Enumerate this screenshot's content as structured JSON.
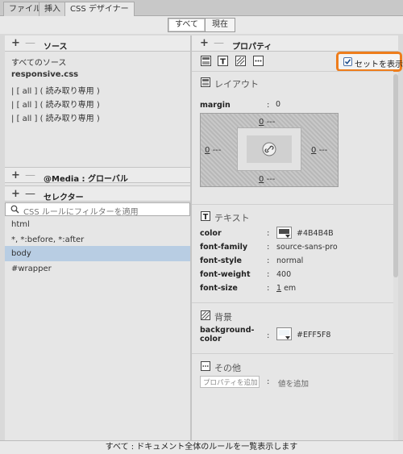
{
  "tabs": [
    {
      "label": "ファイル"
    },
    {
      "label": "挿入"
    },
    {
      "label": "CSS デザイナー"
    }
  ],
  "top_buttons": {
    "all": "すべて",
    "current": "現在"
  },
  "sources": {
    "title": "ソース",
    "all_sources": "すべてのソース",
    "file": "responsive.css",
    "items": [
      "[ all ] ( 読み取り専用 )",
      "[ all ] ( 読み取り専用 )",
      "[ all ] ( 読み取り専用 )"
    ]
  },
  "media": {
    "title": "@Media : グローバル"
  },
  "selectors": {
    "title": "セレクター",
    "filter_placeholder": "CSS ルールにフィルターを適用",
    "items": [
      "html",
      "*, *:before, *:after",
      "body",
      "#wrapper"
    ]
  },
  "properties": {
    "title": "プロパティ",
    "show_set_label": "セットを表示",
    "show_set_checked": true
  },
  "layout": {
    "title": "レイアウト",
    "margin_label": "margin",
    "margin_value": "0",
    "box_top": "0",
    "box_top_dash": "---",
    "box_left": "0",
    "box_left_dash": "---",
    "box_right": "0",
    "box_right_dash": "---",
    "box_bottom": "0",
    "box_bottom_dash": "---"
  },
  "text": {
    "title": "テキスト",
    "props": [
      {
        "name": "color",
        "value": "#4B4B4B"
      },
      {
        "name": "font-family",
        "value": "source-sans-pro"
      },
      {
        "name": "font-style",
        "value": "normal"
      },
      {
        "name": "font-weight",
        "value": "400"
      },
      {
        "name": "font-size",
        "num": "1",
        "unit": "em"
      }
    ],
    "swatch_color": "#4B4B4B"
  },
  "background": {
    "title": "背景",
    "prop_line1": "background-",
    "prop_line2": "color",
    "value": "#EFF5F8",
    "swatch_color": "#EFF5F8"
  },
  "other": {
    "title": "その他",
    "prop_placeholder": "プロパティを追加",
    "value_placeholder": "値を追加"
  },
  "status": {
    "text": "すべて : ドキュメント全体のルールを一覧表示します"
  }
}
